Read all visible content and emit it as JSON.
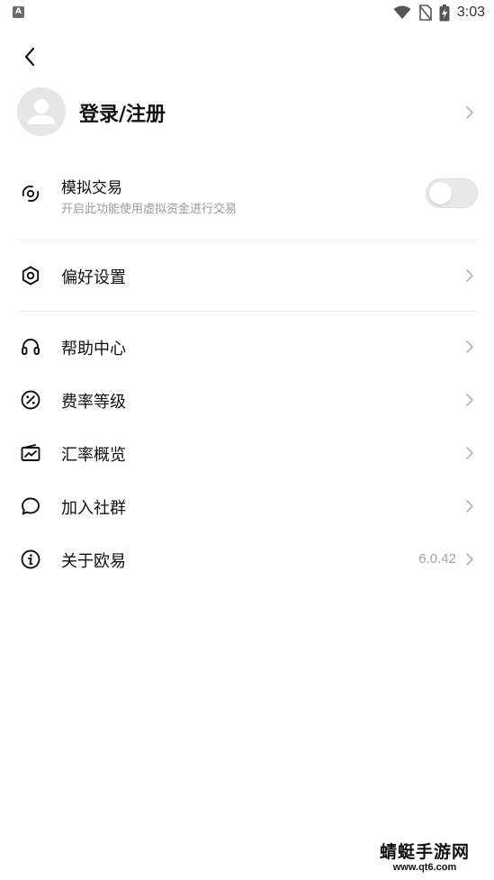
{
  "status_bar": {
    "time": "3:03",
    "app_icon_letter": "A"
  },
  "profile": {
    "label": "登录/注册"
  },
  "simulated_trading": {
    "title": "模拟交易",
    "subtitle": "开启此功能使用虚拟资金进行交易",
    "enabled": false
  },
  "menu": {
    "preferences": {
      "label": "偏好设置",
      "icon": "gear-icon"
    },
    "help": {
      "label": "帮助中心",
      "icon": "headset-icon"
    },
    "fees": {
      "label": "费率等级",
      "icon": "percent-icon"
    },
    "rates": {
      "label": "汇率概览",
      "icon": "chart-wallet-icon"
    },
    "community": {
      "label": "加入社群",
      "icon": "chat-icon"
    },
    "about": {
      "label": "关于欧易",
      "icon": "info-icon",
      "version": "6.0.42"
    }
  },
  "watermark": {
    "title": "蜻蜓手游网",
    "url": "www.qt6.com"
  }
}
